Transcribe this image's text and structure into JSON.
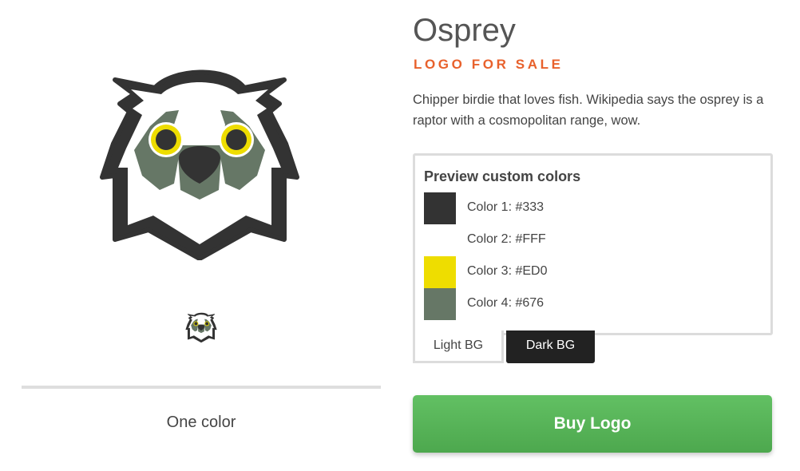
{
  "logo": {
    "name": "Osprey",
    "tag": "LOGO FOR SALE",
    "description": "Chipper birdie that loves fish. Wikipedia says the osprey is a raptor with a cosmopolitan range, wow."
  },
  "preview": {
    "title": "Preview custom colors",
    "colors": [
      {
        "label": "Color 1: #333",
        "hex": "#333333"
      },
      {
        "label": "Color 2: #FFF",
        "hex": "#FFFFFF"
      },
      {
        "label": "Color 3: #ED0",
        "hex": "#EEDD00"
      },
      {
        "label": "Color 4: #676",
        "hex": "#667766"
      }
    ],
    "tabs": {
      "light": "Light BG",
      "dark": "Dark BG"
    }
  },
  "variants": {
    "one_color": "One color"
  },
  "actions": {
    "buy": "Buy Logo"
  },
  "theme": {
    "accent": "#e8612c",
    "buy_green": "#58b459"
  },
  "icons": {
    "large": "osprey-logo-icon",
    "small": "osprey-logo-icon"
  }
}
